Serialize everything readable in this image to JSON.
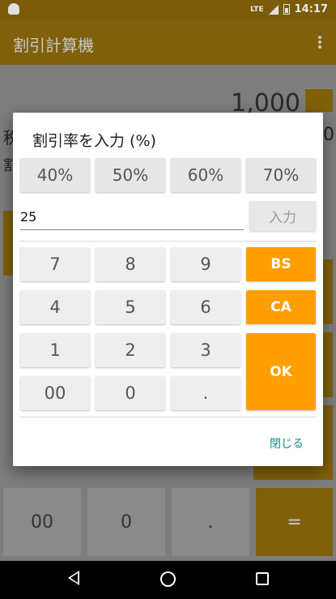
{
  "status_bar": {
    "network": "LTE",
    "time": "14:17"
  },
  "app_bar": {
    "title": "割引計算機"
  },
  "background": {
    "display_value": "1,000",
    "label_tax": "税",
    "right_value": "0",
    "label_discount": "割",
    "bottom_keys": [
      "00",
      "0",
      ".",
      "="
    ]
  },
  "dialog": {
    "title": "割引率を入力 (%)",
    "presets": [
      "40%",
      "50%",
      "60%",
      "70%"
    ],
    "input_value": "25",
    "enter_label": "入力",
    "keys": {
      "k7": "7",
      "k8": "8",
      "k9": "9",
      "k4": "4",
      "k5": "5",
      "k6": "6",
      "k1": "1",
      "k2": "2",
      "k3": "3",
      "k00": "00",
      "k0": "0",
      "kdot": "."
    },
    "bs_label": "BS",
    "ca_label": "CA",
    "ok_label": "OK",
    "close_label": "閉じる"
  },
  "colors": {
    "accent": "#ff9e00",
    "link": "#1a8f8a"
  }
}
